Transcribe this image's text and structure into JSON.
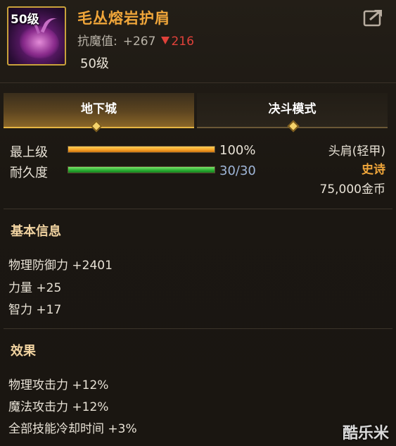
{
  "item": {
    "level_badge": "50级",
    "name": "毛丛熔岩护肩",
    "resist_label": "抗魔值:",
    "resist_value": "+267",
    "resist_down": "216",
    "required_level": "50级"
  },
  "tabs": [
    {
      "label": "地下城",
      "active": true
    },
    {
      "label": "决斗模式",
      "active": false
    }
  ],
  "stats": {
    "grade_label": "最上级",
    "grade_value": "100%",
    "grade_fraction": 1.0,
    "durability_label": "耐久度",
    "durability_value": "30/30",
    "durability_fraction": 1.0
  },
  "meta": {
    "slot_type": "头肩(轻甲)",
    "rarity": "史诗",
    "price": "75,000金币"
  },
  "basic_info": {
    "title": "基本信息",
    "lines": [
      "物理防御力 +2401",
      "力量 +25",
      "智力 +17"
    ]
  },
  "effects": {
    "title": "效果",
    "lines": [
      "物理攻击力 +12%",
      "魔法攻击力 +12%",
      "全部技能冷却时间 +3%"
    ]
  },
  "watermark": "酷乐米",
  "colors": {
    "name": "#f0a63a",
    "rarity_epic": "#f0a63a",
    "decrease": "#e0413a",
    "durability_text": "#9fb6d8",
    "tab_active_accent": "#e5b543"
  },
  "icons": {
    "share": "share-export-icon",
    "item": "lava-beast-shoulder-icon"
  }
}
